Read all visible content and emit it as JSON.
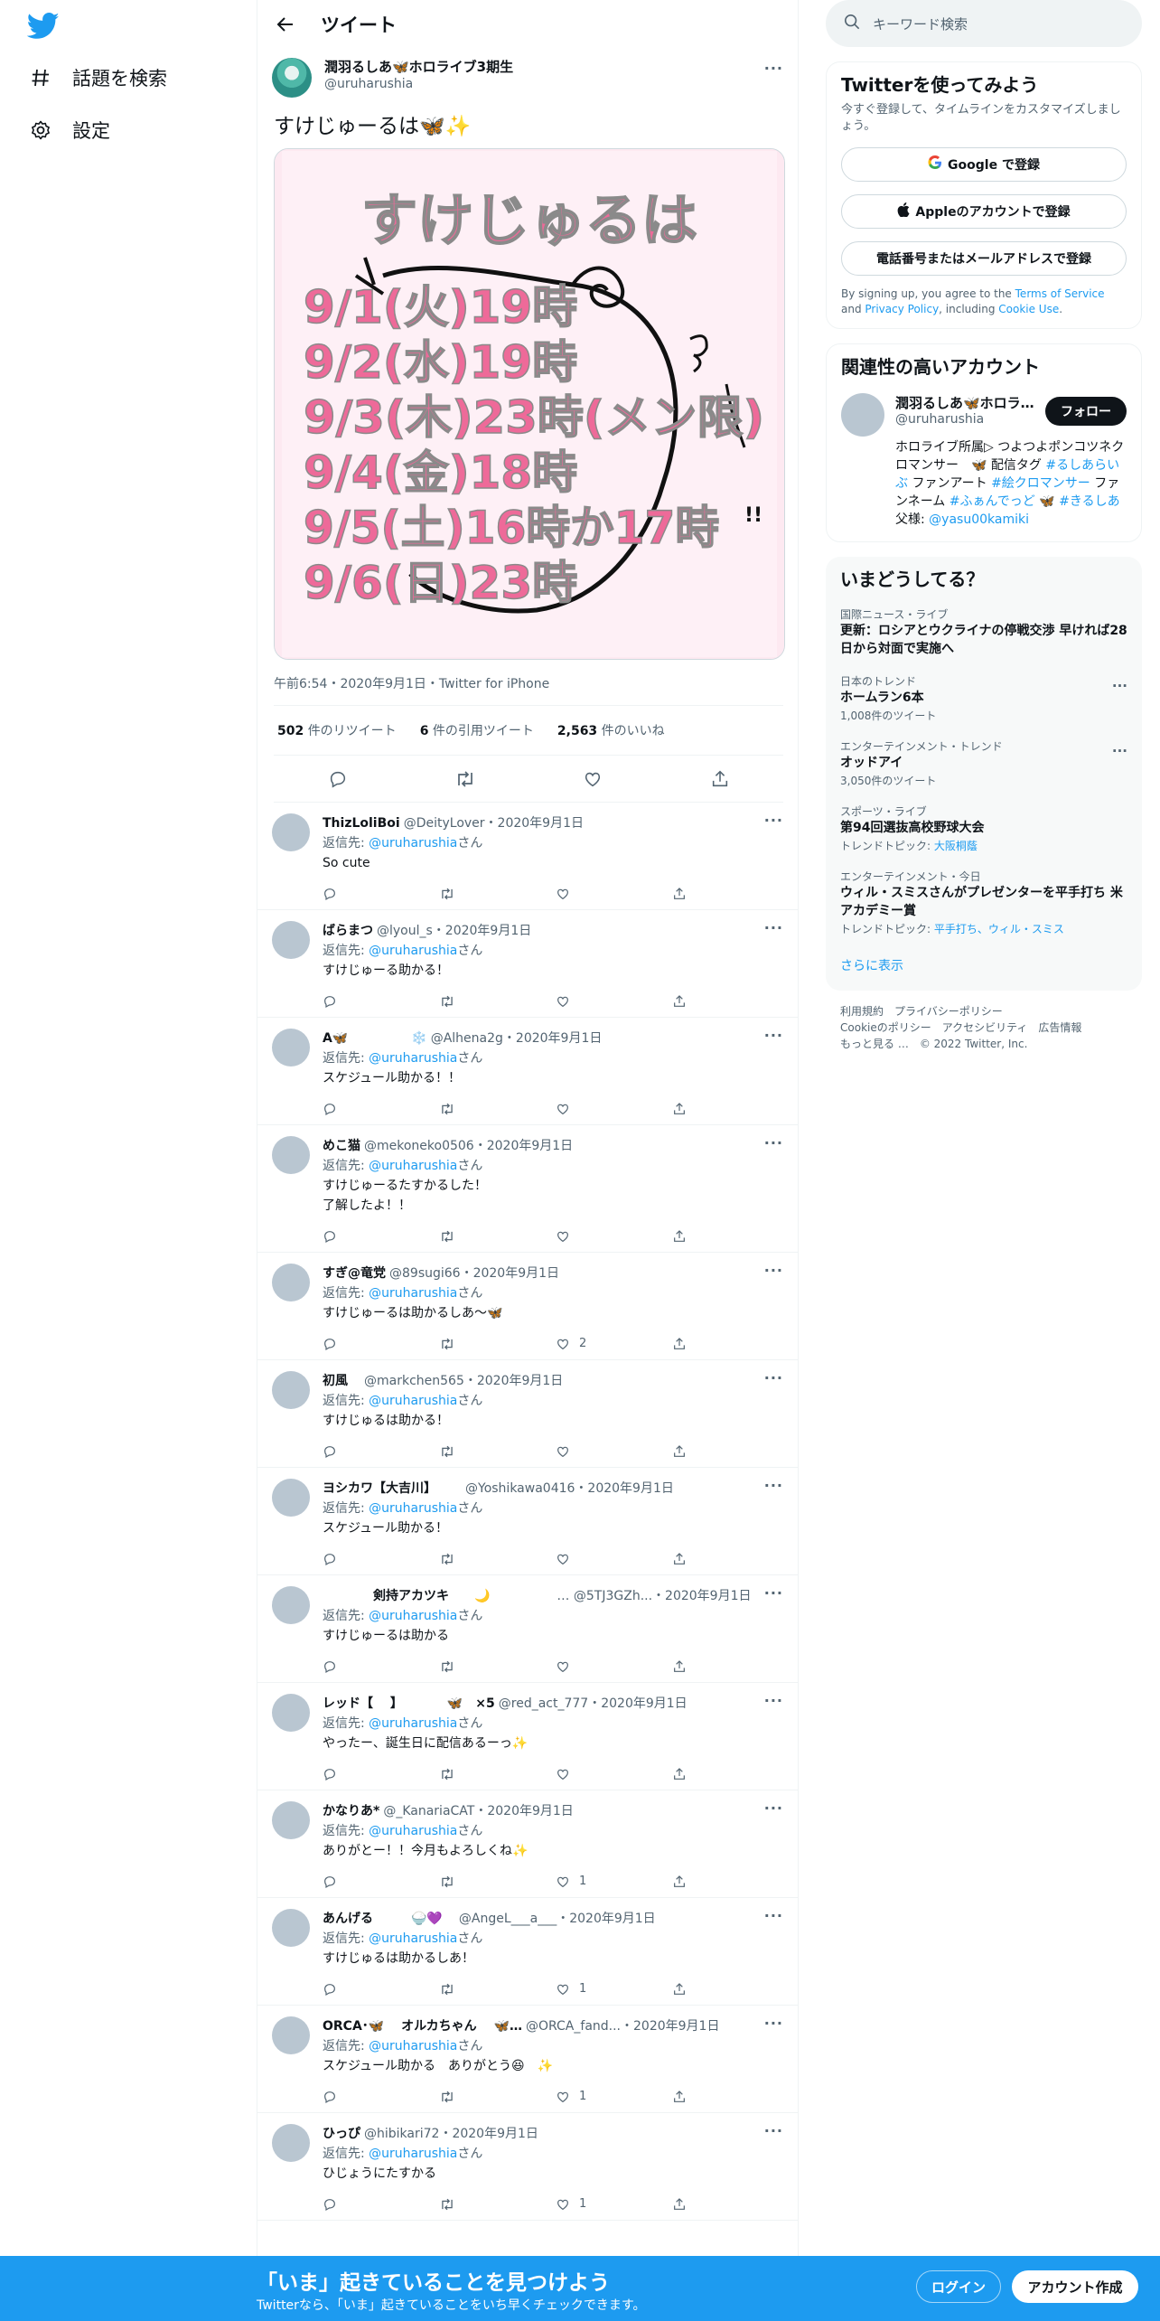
{
  "nav": {
    "explore_label": "話題を検索",
    "settings_label": "設定"
  },
  "header": {
    "title": "ツイート"
  },
  "tweet": {
    "author_name": "潤羽るしあ🦋ホロライブ3期生",
    "author_handle": "@uruharushia",
    "text": "すけじゅーるは🦋✨",
    "image_text": {
      "title": "すけじゅるは",
      "lines": [
        "9/1(火)19時",
        "9/2(水)19時",
        "9/3(木)23時(メン限)",
        "9/4(金)18時",
        "9/5(土)16時か17時",
        "9/6(日)23時"
      ]
    },
    "meta": "午前6:54・2020年9月1日・Twitter for iPhone",
    "retweets": "502",
    "retweets_label": "件のリツイート",
    "quotes": "6",
    "quotes_label": "件の引用ツイート",
    "likes": "2,563",
    "likes_label": "件のいいね"
  },
  "replies": [
    {
      "name": "ThizLoliBoi",
      "handle": "@DeityLover",
      "date": "・2020年9月1日",
      "text": "So cute",
      "likes": ""
    },
    {
      "name": "ばらまつ",
      "handle": "@lyoul_s",
      "date": "・2020年9月1日",
      "text": "すけじゅーる助かる！",
      "likes": ""
    },
    {
      "name": "A🦋　　　　　❄️",
      "handle": "@Alhena2g",
      "date": "・2020年9月1日",
      "text": "スケジュール助かる！！",
      "likes": ""
    },
    {
      "name": "めこ猫",
      "handle": "@mekoneko0506",
      "date": "・2020年9月1日",
      "text": "すけじゅーるたすかるした！\n了解したよ！！",
      "likes": ""
    },
    {
      "name": "すぎ@竜党",
      "handle": "@89sugi66",
      "date": "・2020年9月1日",
      "text": "すけじゅーるは助かるしあ〜🦋",
      "likes": "2"
    },
    {
      "name": "初風",
      "handle": "　@markchen565",
      "date": "・2020年9月1日",
      "text": "すけじゅるは助かる！",
      "likes": ""
    },
    {
      "name": "ヨシカワ【大吉川】",
      "handle": "　　@Yoshikawa0416",
      "date": "・2020年9月1日",
      "text": "スケジュール助かる！",
      "likes": ""
    },
    {
      "name": "　　　　剣持アカツキ　　🌙",
      "handle": "　　　　　… @5TJ3GZh...",
      "date": "・2020年9月1日",
      "text": "すけじゅーるは助かる",
      "likes": ""
    },
    {
      "name": "レッド【　 】　　　　🦋　×5",
      "handle": "@red_act_777",
      "date": "・2020年9月1日",
      "text": "やったー、誕生日に配信あるーっ✨",
      "likes": ""
    },
    {
      "name": "かなりあ*",
      "handle": "@_KanariaCAT",
      "date": "・2020年9月1日",
      "text": "ありがとー！！今月もよろしくね✨",
      "likes": "1"
    },
    {
      "name": "あんげる　　　🍚💜",
      "handle": "　@AngeL___a___",
      "date": "・2020年9月1日",
      "text": "すけじゅるは助かるしあ！",
      "likes": "1"
    },
    {
      "name": "ORCA･🦋　 オルカちゃん　 🦋…",
      "handle": "@ORCA_fand...",
      "date": "・2020年9月1日",
      "text": "スケジュール助かる　ありがとう😆　✨",
      "likes": "1"
    },
    {
      "name": "ひっぴ",
      "handle": "@hibikari72",
      "date": "・2020年9月1日",
      "text": "ひじょうにたすかる",
      "likes": "1"
    }
  ],
  "reply_prefix": "返信先: ",
  "reply_target": "@uruharushia",
  "reply_suffix": "さん",
  "right": {
    "search_placeholder": "キーワード検索",
    "signup_title": "Twitterを使ってみよう",
    "signup_sub": "今すぐ登録して、タイムラインをカスタマイズしましょう。",
    "google_label": "Google で登録",
    "apple_label": "Appleのアカウントで登録",
    "phone_label": "電話番号またはメールアドレスで登録",
    "terms_pre": "By signing up, you agree to the ",
    "terms_tos": "Terms of Service",
    "terms_and": " and ",
    "terms_privacy": "Privacy Policy",
    "terms_incl": ", including ",
    "terms_cookie": "Cookie Use",
    "terms_end": ".",
    "rel_title": "関連性の高いアカウント",
    "rel_name": "潤羽るしあ🦋ホロラ…",
    "rel_handle": "@uruharushia",
    "follow_label": "フォロー",
    "rel_bio_1": "ホロライブ所属▷ つよつよポンコツネクロマンサー　🦋 配信タグ ",
    "rel_bio_tag1": "#るしあらいぶ",
    "rel_bio_2": " ファンアート ",
    "rel_bio_tag2": "#絵クロマンサー",
    "rel_bio_3": " ファンネーム ",
    "rel_bio_tag3": "#ふぁんでっど",
    "rel_bio_4": " 🦋 ",
    "rel_bio_tag4": "#きるしあ",
    "rel_bio_5": " 父様: ",
    "rel_bio_tag5": "@yasu00kamiki",
    "trends_title": "いまどうしてる？",
    "trends": [
      {
        "ctx": "国際ニュース・ライブ",
        "title": "更新：ロシアとウクライナの停戦交渉 早ければ28日から対面で実施へ",
        "count": "",
        "topic_label": "",
        "topic": ""
      },
      {
        "ctx": "日本のトレンド",
        "title": "ホームラン6本",
        "count": "1,008件のツイート",
        "topic_label": "",
        "topic": ""
      },
      {
        "ctx": "エンターテインメント・トレンド",
        "title": "オッドアイ",
        "count": "3,050件のツイート",
        "topic_label": "",
        "topic": ""
      },
      {
        "ctx": "スポーツ・ライブ",
        "title": "第94回選抜高校野球大会",
        "count": "",
        "topic_label": "トレンドトピック: ",
        "topic": "大阪桐蔭"
      },
      {
        "ctx": "エンターテインメント・今日",
        "title": "ウィル・スミスさんがプレゼンターを平手打ち 米アカデミー賞",
        "count": "",
        "topic_label": "トレンドトピック: ",
        "topic": "平手打ち、ウィル・スミス"
      }
    ],
    "show_more": "さらに表示",
    "footer_links": [
      "利用規約",
      "プライバシーポリシー",
      "Cookieのポリシー",
      "アクセシビリティ",
      "広告情報",
      "もっと見る …",
      "© 2022 Twitter, Inc."
    ]
  },
  "bottombar": {
    "title": "「いま」起きていることを見つけよう",
    "subtitle": "Twitterなら、「いま」起きていることをいち早くチェックできます。",
    "login_label": "ログイン",
    "signup_label": "アカウント作成"
  },
  "colors": {
    "accent": "#1d9bf0",
    "image_bg": "#fde9f1",
    "image_text": "#ee6a99"
  }
}
